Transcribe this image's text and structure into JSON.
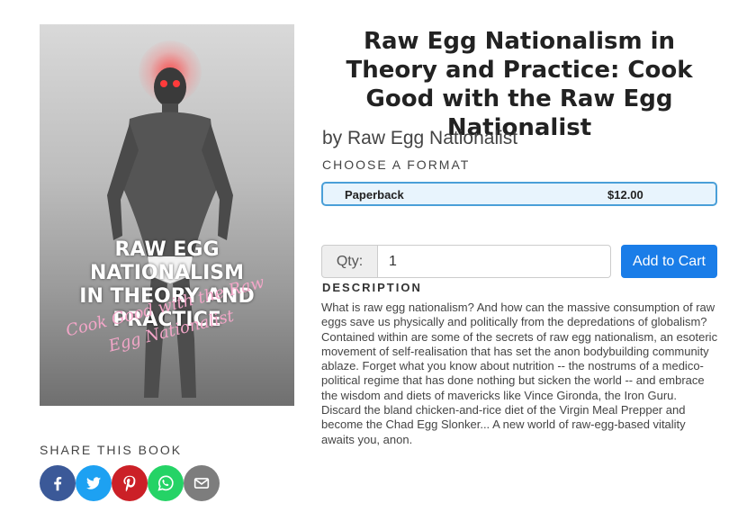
{
  "book": {
    "title": "Raw Egg Nationalism in Theory and Practice: Cook Good with the Raw Egg Nationalist",
    "author": "by Raw Egg Nationalist",
    "cover": {
      "title_line1": "RAW EGG NATIONALISM",
      "title_line2": "IN THEORY AND PRACTICE",
      "script_line1": "Cook Good with the Raw",
      "script_line2": "Egg Nationalist"
    }
  },
  "format": {
    "label": "CHOOSE A FORMAT",
    "selected_name": "Paperback",
    "selected_price": "$12.00"
  },
  "purchase": {
    "qty_label": "Qty:",
    "qty_value": "1",
    "add_button": "Add to Cart"
  },
  "description": {
    "label": "DESCRIPTION",
    "text": "What is raw egg nationalism? And how can the massive consumption of raw eggs save us physically and politically from the depredations of globalism? Contained within are some of the secrets of raw egg nationalism, an esoteric movement of self-realisation that has set the anon bodybuilding community ablaze. Forget what you know about nutrition -- the nostrums of a medico-political regime that has done nothing but sicken the world -- and embrace the wisdom and diets of mavericks like Vince Gironda, the Iron Guru. Discard the bland chicken-and-rice diet of the Virgin Meal Prepper and become the Chad Egg Slonker... A new world of raw-egg-based vitality awaits you, anon."
  },
  "share": {
    "label": "SHARE THIS BOOK",
    "buttons": [
      {
        "icon": "facebook-icon",
        "color": "#3b5998"
      },
      {
        "icon": "twitter-icon",
        "color": "#1da1f2"
      },
      {
        "icon": "pinterest-icon",
        "color": "#cb2027"
      },
      {
        "icon": "whatsapp-icon",
        "color": "#25d366"
      },
      {
        "icon": "email-icon",
        "color": "#7d7d7d"
      }
    ]
  },
  "colors": {
    "accent": "#1a7de8",
    "format_border": "#4a9fd8",
    "format_bg": "#e8f4fd"
  }
}
